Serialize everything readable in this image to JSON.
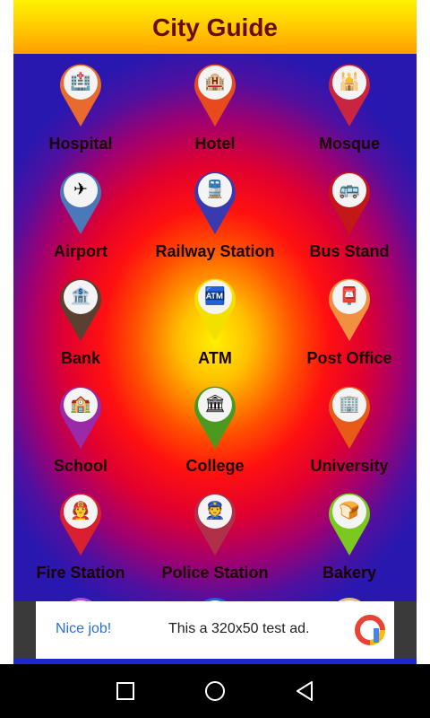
{
  "app": {
    "title": "City Guide"
  },
  "categories": [
    {
      "label": "Hospital",
      "icon": "hospital-icon",
      "glyph": "🏥",
      "color": "#e86a2c"
    },
    {
      "label": "Hotel",
      "icon": "hotel-icon",
      "glyph": "🏨",
      "color": "#e84a1e"
    },
    {
      "label": "Mosque",
      "icon": "mosque-icon",
      "glyph": "🕌",
      "color": "#c92440"
    },
    {
      "label": "Airport",
      "icon": "airport-icon",
      "glyph": "✈",
      "color": "#4a78b8"
    },
    {
      "label": "Railway Station",
      "icon": "train-icon",
      "glyph": "🚆",
      "color": "#3a3ab0"
    },
    {
      "label": "Bus Stand",
      "icon": "bus-icon",
      "glyph": "🚌",
      "color": "#c41818"
    },
    {
      "label": "Bank",
      "icon": "bank-icon",
      "glyph": "🏦",
      "color": "#5a4030"
    },
    {
      "label": "ATM",
      "icon": "atm-icon",
      "glyph": "🏧",
      "color": "#f2e000"
    },
    {
      "label": "Post Office",
      "icon": "post-office-icon",
      "glyph": "📮",
      "color": "#f09040"
    },
    {
      "label": "School",
      "icon": "school-icon",
      "glyph": "🏫",
      "color": "#9a2aa8"
    },
    {
      "label": "College",
      "icon": "college-icon",
      "glyph": "🏛",
      "color": "#4a9a20"
    },
    {
      "label": "University",
      "icon": "university-icon",
      "glyph": "🏢",
      "color": "#e85a18"
    },
    {
      "label": "Fire Station",
      "icon": "firefighter-icon",
      "glyph": "🧑‍🚒",
      "color": "#d82030"
    },
    {
      "label": "Police Station",
      "icon": "police-icon",
      "glyph": "👮",
      "color": "#b0304a"
    },
    {
      "label": "Bakery",
      "icon": "bakery-icon",
      "glyph": "🍞",
      "color": "#7ac820"
    }
  ],
  "ad": {
    "badge": "Nice job!",
    "text": "This a 320x50 test ad."
  },
  "nav": {
    "recents": "recents-icon",
    "home": "home-icon",
    "back": "back-icon"
  }
}
